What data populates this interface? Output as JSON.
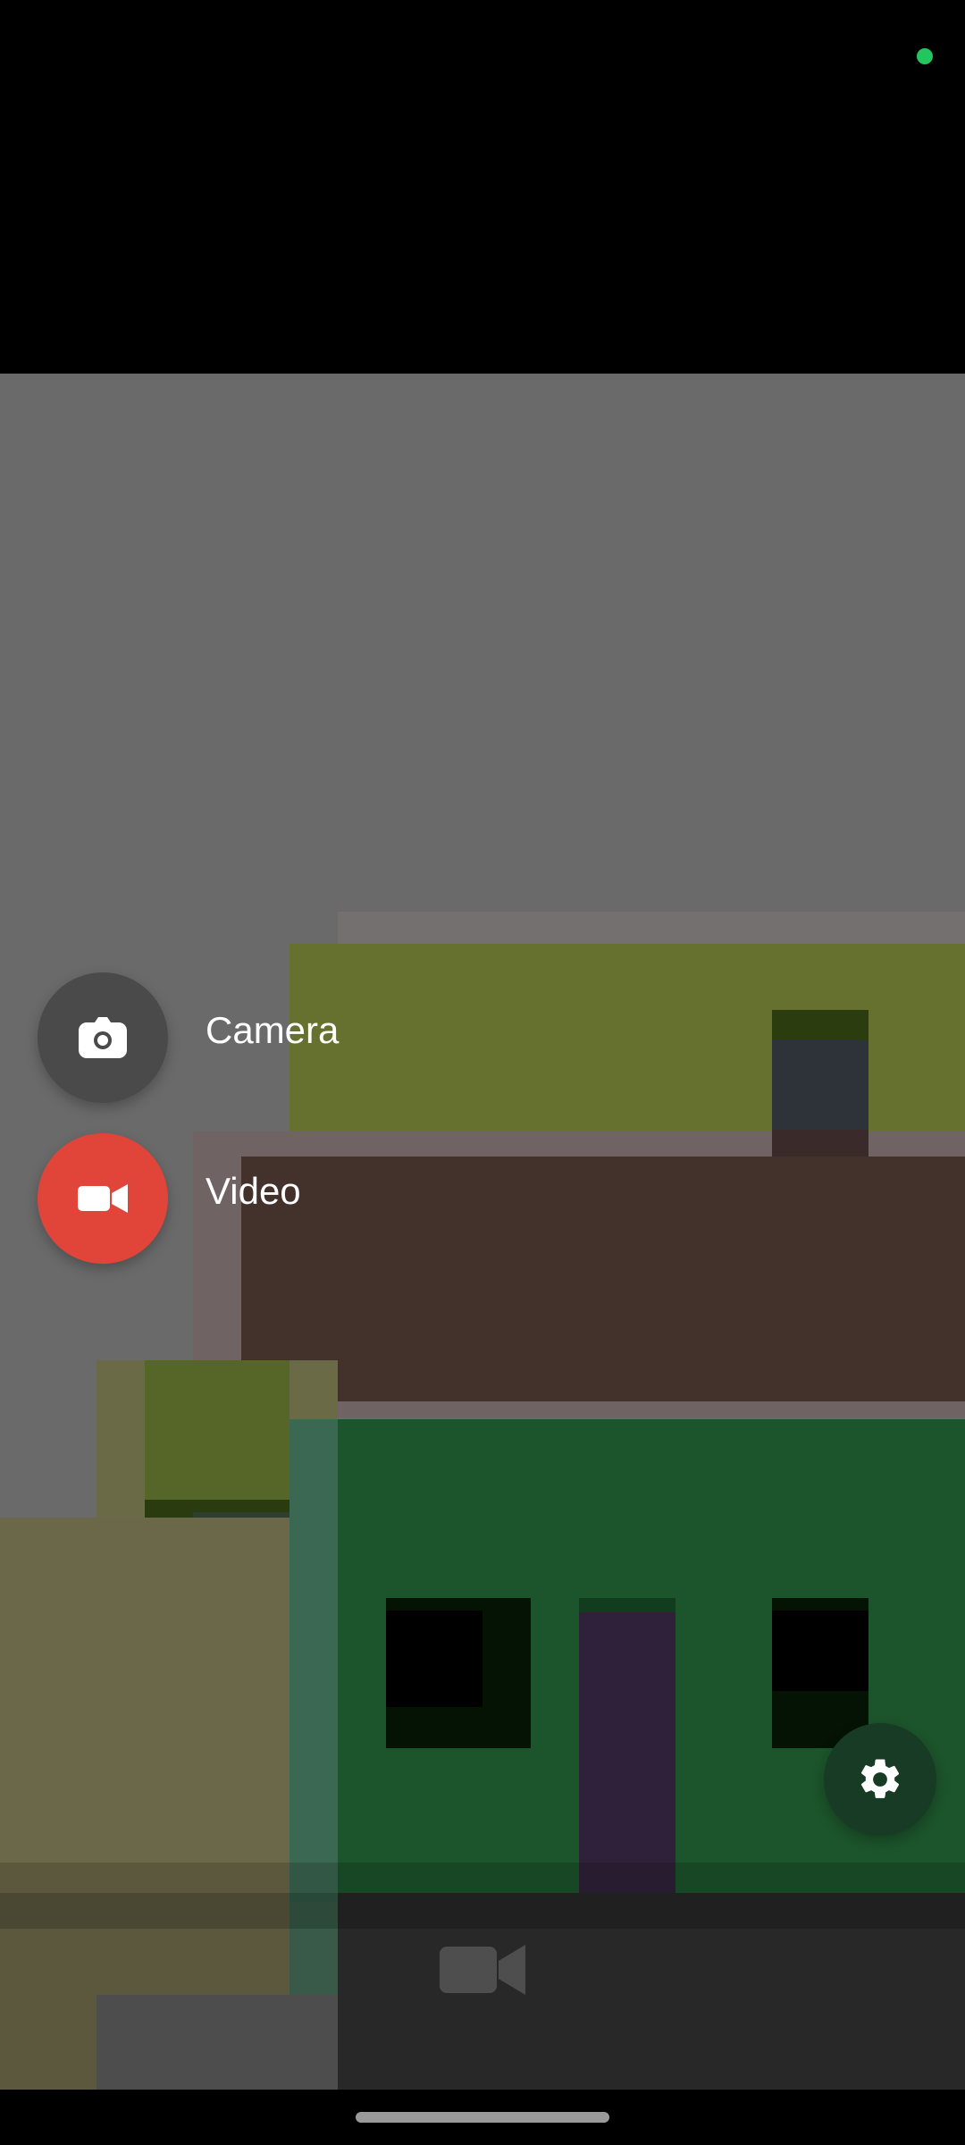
{
  "status_bar": {
    "indicator": {
      "icon": "status-dot",
      "color": "#22c55e"
    }
  },
  "menu": {
    "camera": {
      "label": "Camera",
      "icon": "camera-icon",
      "bg": "#4a4a4a"
    },
    "video": {
      "label": "Video",
      "icon": "video-icon",
      "bg": "#e1453a"
    }
  },
  "controls": {
    "settings": {
      "icon": "gear-icon"
    },
    "record": {
      "icon": "video-record-icon"
    }
  },
  "navigation": {
    "home_indicator": {
      "icon": "home-pill"
    }
  }
}
